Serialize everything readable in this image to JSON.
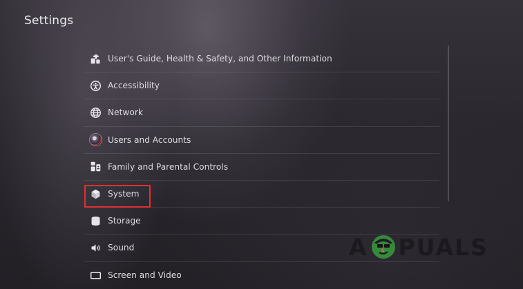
{
  "page": {
    "title": "Settings"
  },
  "menu": {
    "items": [
      {
        "label": "User's Guide, Health & Safety, and Other Information",
        "icon": "guide-icon"
      },
      {
        "label": "Accessibility",
        "icon": "accessibility-icon"
      },
      {
        "label": "Network",
        "icon": "globe-icon"
      },
      {
        "label": "Users and Accounts",
        "icon": "avatar"
      },
      {
        "label": "Family and Parental Controls",
        "icon": "family-icon"
      },
      {
        "label": "System",
        "icon": "cube-icon"
      },
      {
        "label": "Storage",
        "icon": "storage-icon"
      },
      {
        "label": "Sound",
        "icon": "speaker-icon"
      },
      {
        "label": "Screen and Video",
        "icon": "screen-icon"
      }
    ],
    "selected_index": 5
  },
  "watermark": {
    "left_text": "A",
    "right_text": "PUALS"
  },
  "colors": {
    "highlight_border": "#e03131",
    "text": "#dedbe1"
  }
}
